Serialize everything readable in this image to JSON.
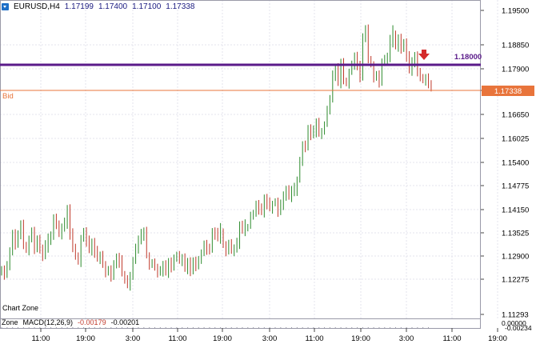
{
  "header": {
    "symbol": "EURUSD,H4",
    "open": "1.17199",
    "high": "1.17400",
    "low": "1.17100",
    "close": "1.17338"
  },
  "price_axis": {
    "ticks": [
      "1.19500",
      "1.18850",
      "1.17900",
      "1.17250",
      "1.16650",
      "1.16025",
      "1.15400",
      "1.14775",
      "1.14150",
      "1.13525",
      "1.12900",
      "1.12275",
      "1.11293"
    ],
    "resistance_label": "1.18000",
    "bid_label": "1.17338"
  },
  "time_axis": {
    "ticks": [
      "11:00",
      "19:00",
      "3:00",
      "11:00",
      "19:00",
      "3:00",
      "11:00",
      "19:00",
      "3:00",
      "11:00",
      "19:00"
    ]
  },
  "lines": {
    "bid_text": "Bid",
    "bid_color": "#e8743b",
    "resistance_color": "#5a1a8a"
  },
  "zones": {
    "chart_zone": "Chart Zone",
    "zone_label": "Zone"
  },
  "macd": {
    "label": "MACD(12,26,9)",
    "value1": "-0.00179",
    "value2": "-0.00201",
    "axis_top": "0.00000",
    "axis_bottom": "-0.00234"
  },
  "colors": {
    "bull": "#2e8b2e",
    "bear": "#c0392b",
    "grid": "#e3e3ec",
    "arrow": "#d42a2a"
  },
  "chart_data": {
    "type": "candlestick",
    "symbol": "EURUSD",
    "timeframe": "H4",
    "ylim": [
      1.1112,
      1.1965
    ],
    "resistance": 1.18,
    "bid": 1.17338,
    "closes": [
      1.1245,
      1.1228,
      1.1255,
      1.129,
      1.1335,
      1.1312,
      1.133,
      1.1355,
      1.131,
      1.1295,
      1.1325,
      1.1345,
      1.13,
      1.132,
      1.1292,
      1.1278,
      1.1302,
      1.1318,
      1.1338,
      1.1382,
      1.1362,
      1.1336,
      1.1352,
      1.1366,
      1.1398,
      1.1332,
      1.1305,
      1.128,
      1.1262,
      1.1325,
      1.1342,
      1.1318,
      1.1296,
      1.1308,
      1.1285,
      1.127,
      1.1284,
      1.1255,
      1.1236,
      1.124,
      1.1226,
      1.1252,
      1.1268,
      1.126,
      1.1232,
      1.1219,
      1.1202,
      1.1226,
      1.1264,
      1.1298,
      1.1318,
      1.1334,
      1.1336,
      1.1282,
      1.1258,
      1.1262,
      1.1246,
      1.1234,
      1.1238,
      1.125,
      1.1236,
      1.1254,
      1.1246,
      1.1276,
      1.1282,
      1.1266,
      1.1272,
      1.1246,
      1.1258,
      1.1236,
      1.1256,
      1.1251,
      1.1272,
      1.1288,
      1.131,
      1.1298,
      1.1294,
      1.1338,
      1.1335,
      1.1326,
      1.1346,
      1.131,
      1.1294,
      1.1312,
      1.1291,
      1.1296,
      1.1312,
      1.1354,
      1.1348,
      1.1356,
      1.1358,
      1.1389,
      1.1392,
      1.1415,
      1.1404,
      1.1398,
      1.1426,
      1.1415,
      1.1405,
      1.142,
      1.1425,
      1.1398,
      1.1418,
      1.1438,
      1.1451,
      1.1436,
      1.1447,
      1.1454,
      1.1485,
      1.1536,
      1.1576,
      1.1568,
      1.1616,
      1.1602,
      1.1611,
      1.1628,
      1.1608,
      1.1615,
      1.1631,
      1.1671,
      1.1698,
      1.1762,
      1.1778,
      1.1744,
      1.1788,
      1.175,
      1.174,
      1.1772,
      1.1792,
      1.1812,
      1.1786,
      1.176,
      1.1858,
      1.1878,
      1.1808,
      1.1792,
      1.1758,
      1.1764,
      1.1746,
      1.1794,
      1.1802,
      1.1806,
      1.1852,
      1.1876,
      1.1842,
      1.1864,
      1.1832,
      1.1848,
      1.1812,
      1.1776,
      1.1794,
      1.1806,
      1.1776,
      1.1758,
      1.1748,
      1.1756,
      1.1736,
      1.1734
    ]
  }
}
